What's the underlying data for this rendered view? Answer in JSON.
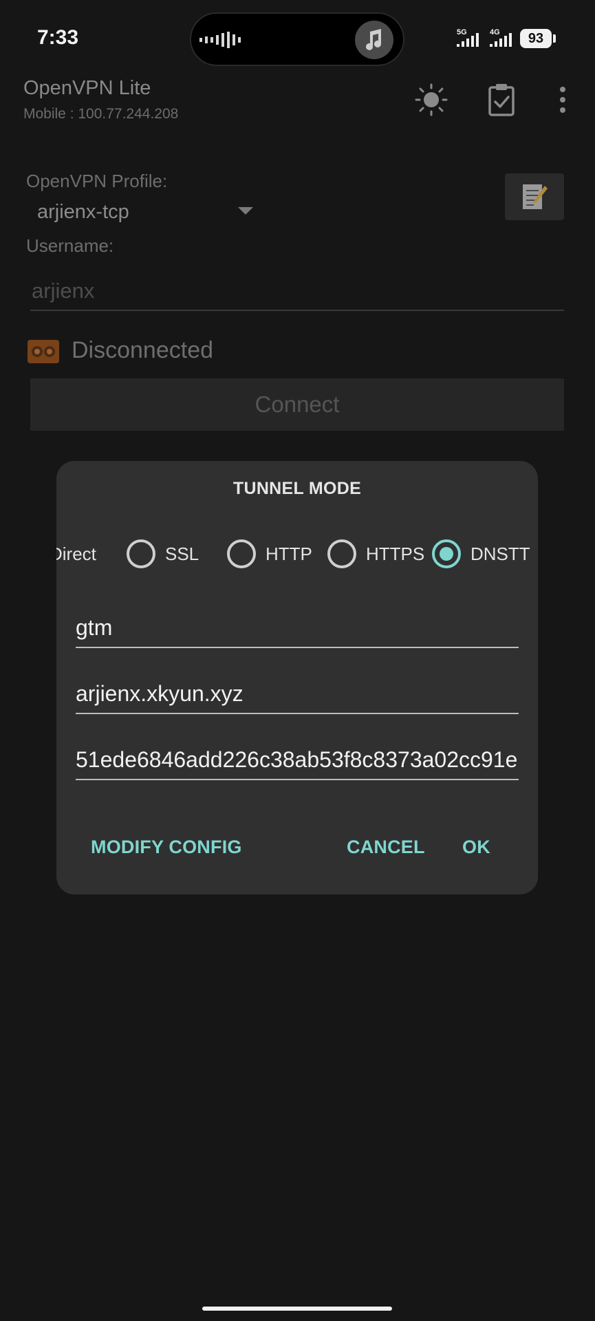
{
  "status_bar": {
    "time": "7:33",
    "network_primary": "5G",
    "network_secondary": "4G",
    "battery": "93"
  },
  "app_bar": {
    "title": "OpenVPN Lite",
    "subtitle": "Mobile : 100.77.244.208",
    "icons": [
      "brightness-icon",
      "clipboard-check-icon",
      "more-vert-icon"
    ]
  },
  "main": {
    "profile_label": "OpenVPN Profile:",
    "profile_value": "arjienx-tcp",
    "username_label": "Username:",
    "username_value": "arjienx",
    "status_text": "Disconnected",
    "connect_label": "Connect"
  },
  "dialog": {
    "title": "TUNNEL MODE",
    "options": [
      {
        "label": "Direct",
        "checked": false
      },
      {
        "label": "SSL",
        "checked": false
      },
      {
        "label": "HTTP",
        "checked": false
      },
      {
        "label": "HTTPS",
        "checked": false
      },
      {
        "label": "DNSTT",
        "checked": true
      }
    ],
    "fields": [
      {
        "value": "gtm"
      },
      {
        "value": "arjienx.xkyun.xyz"
      },
      {
        "value": "51ede6846add226c38ab53f8c8373a02cc91e"
      }
    ],
    "modify_label": "MODIFY CONFIG",
    "cancel_label": "CANCEL",
    "ok_label": "OK"
  },
  "colors": {
    "accent": "#7fd6cf",
    "background": "#161616",
    "dialog": "#303030"
  }
}
